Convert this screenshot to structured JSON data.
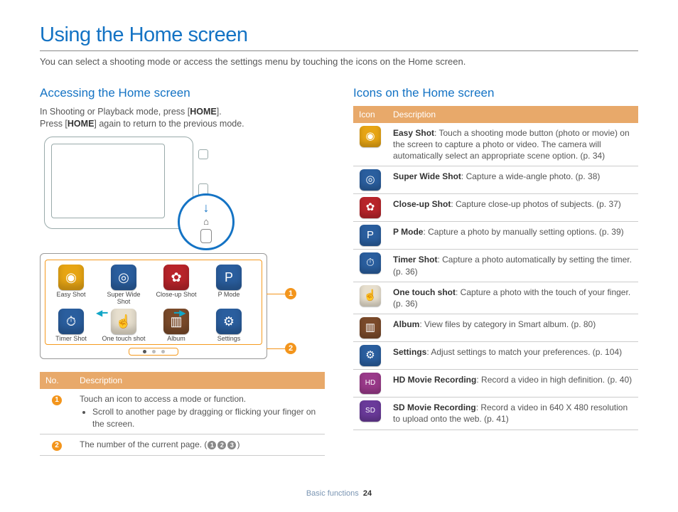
{
  "title": "Using the Home screen",
  "subtitle": "You can select a shooting mode or access the settings menu by touching the icons on the Home screen.",
  "left": {
    "heading": "Accessing the Home screen",
    "text1a": "In Shooting or Playback mode, press [",
    "text1b": "HOME",
    "text1c": "].",
    "text2a": "Press [",
    "text2b": "HOME",
    "text2c": "] again to return to the previous mode.",
    "apps": [
      {
        "label": "Easy Shot",
        "bg": "#e7a514",
        "glyph": "◉"
      },
      {
        "label": "Super Wide Shot",
        "bg": "#2a5e9e",
        "glyph": "◎"
      },
      {
        "label": "Close-up Shot",
        "bg": "#b8242a",
        "glyph": "✿"
      },
      {
        "label": "P Mode",
        "bg": "#2a5e9e",
        "glyph": "P"
      },
      {
        "label": "Timer Shot",
        "bg": "#2a5e9e",
        "glyph": "⏱"
      },
      {
        "label": "One touch shot",
        "bg": "#e7dfce",
        "glyph": "☝",
        "fg": "#555"
      },
      {
        "label": "Album",
        "bg": "#7a4a2a",
        "glyph": "▥"
      },
      {
        "label": "Settings",
        "bg": "#2a5e9e",
        "glyph": "⚙"
      }
    ],
    "table": {
      "h1": "No.",
      "h2": "Description",
      "rows": [
        {
          "n": "1",
          "d": "Touch an icon to access a mode or function.",
          "bullet": "Scroll to another page by dragging or flicking your finger on the screen."
        },
        {
          "n": "2",
          "d": "The number of the current page. ("
        }
      ],
      "pageglyphs": [
        "1",
        "2",
        "3"
      ],
      "close": ")"
    }
  },
  "right": {
    "heading": "Icons on the Home screen",
    "h1": "Icon",
    "h2": "Description",
    "rows": [
      {
        "bg": "#e7a514",
        "g": "◉",
        "b": "Easy Shot",
        "d": ": Touch a shooting mode button (photo or movie) on the screen to capture a photo or video. The camera will automatically select an appropriate scene option. (p. 34)"
      },
      {
        "bg": "#2a5e9e",
        "g": "◎",
        "b": "Super Wide Shot",
        "d": ": Capture a wide-angle photo. (p. 38)"
      },
      {
        "bg": "#b8242a",
        "g": "✿",
        "b": "Close-up Shot",
        "d": ": Capture close-up photos of subjects. (p. 37)"
      },
      {
        "bg": "#2a5e9e",
        "g": "P",
        "b": "P Mode",
        "d": ": Capture a photo by manually setting options. (p. 39)"
      },
      {
        "bg": "#2a5e9e",
        "g": "⏱",
        "b": "Timer Shot",
        "d": ": Capture a photo automatically by setting the timer. (p. 36)"
      },
      {
        "bg": "#e7dfce",
        "g": "☝",
        "fg": "#555",
        "b": "One touch shot",
        "d": ": Capture a photo with the touch of your finger. (p. 36)"
      },
      {
        "bg": "#7a4a2a",
        "g": "▥",
        "b": "Album",
        "d": ": View files by category in Smart album. (p. 80)"
      },
      {
        "bg": "#2a5e9e",
        "g": "⚙",
        "b": "Settings",
        "d": ": Adjust settings to match your preferences. (p. 104)"
      },
      {
        "bg": "#9a3a8a",
        "g": "HD",
        "fs": "10px",
        "b": "HD Movie Recording",
        "d": ": Record a video in high definition. (p. 40)"
      },
      {
        "bg": "#6a3a9a",
        "g": "SD",
        "fs": "10px",
        "b": "SD Movie Recording",
        "d": ": Record a video in 640 X 480 resolution to upload onto the web. (p. 41)"
      }
    ]
  },
  "footer": {
    "section": "Basic functions",
    "page": "24"
  }
}
